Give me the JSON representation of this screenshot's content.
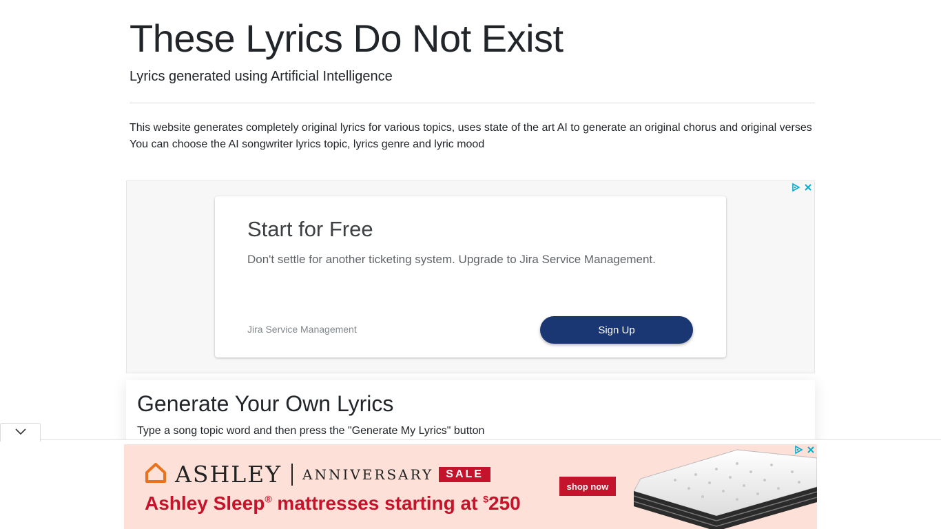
{
  "header": {
    "title": "These Lyrics Do Not Exist",
    "subtitle": "Lyrics generated using Artificial Intelligence"
  },
  "intro": {
    "line1": "This website generates completely original lyrics for various topics, uses state of the art AI to generate an original chorus and original verses",
    "line2": "You can choose the AI songwriter lyrics topic, lyrics genre and lyric mood"
  },
  "ad_top": {
    "headline": "Start for Free",
    "description": "Don't settle for another ticketing system. Upgrade to Jira Service Management.",
    "advertiser": "Jira Service Management",
    "cta_label": "Sign Up",
    "cta_color": "#1a3673"
  },
  "generator": {
    "title": "Generate Your Own Lyrics",
    "instructions": "Type a song topic word and then press the \"Generate My Lyrics\" button"
  },
  "ad_bottom": {
    "brand": "ASHLEY",
    "tagline": "ANNIVERSARY",
    "sale_label": "SALE",
    "cta_label": "shop now",
    "headline_text": "Ashley Sleep",
    "headline_mark": "®",
    "headline_rest": " mattresses starting at ",
    "price_currency": "$",
    "price_amount": "250",
    "brand_color": "#c4132a",
    "background_color": "#fde1d8"
  },
  "icons": {
    "adchoices": "adchoices-icon",
    "close": "close-icon",
    "collapse": "chevron-down-icon",
    "house": "house-logo-icon"
  }
}
